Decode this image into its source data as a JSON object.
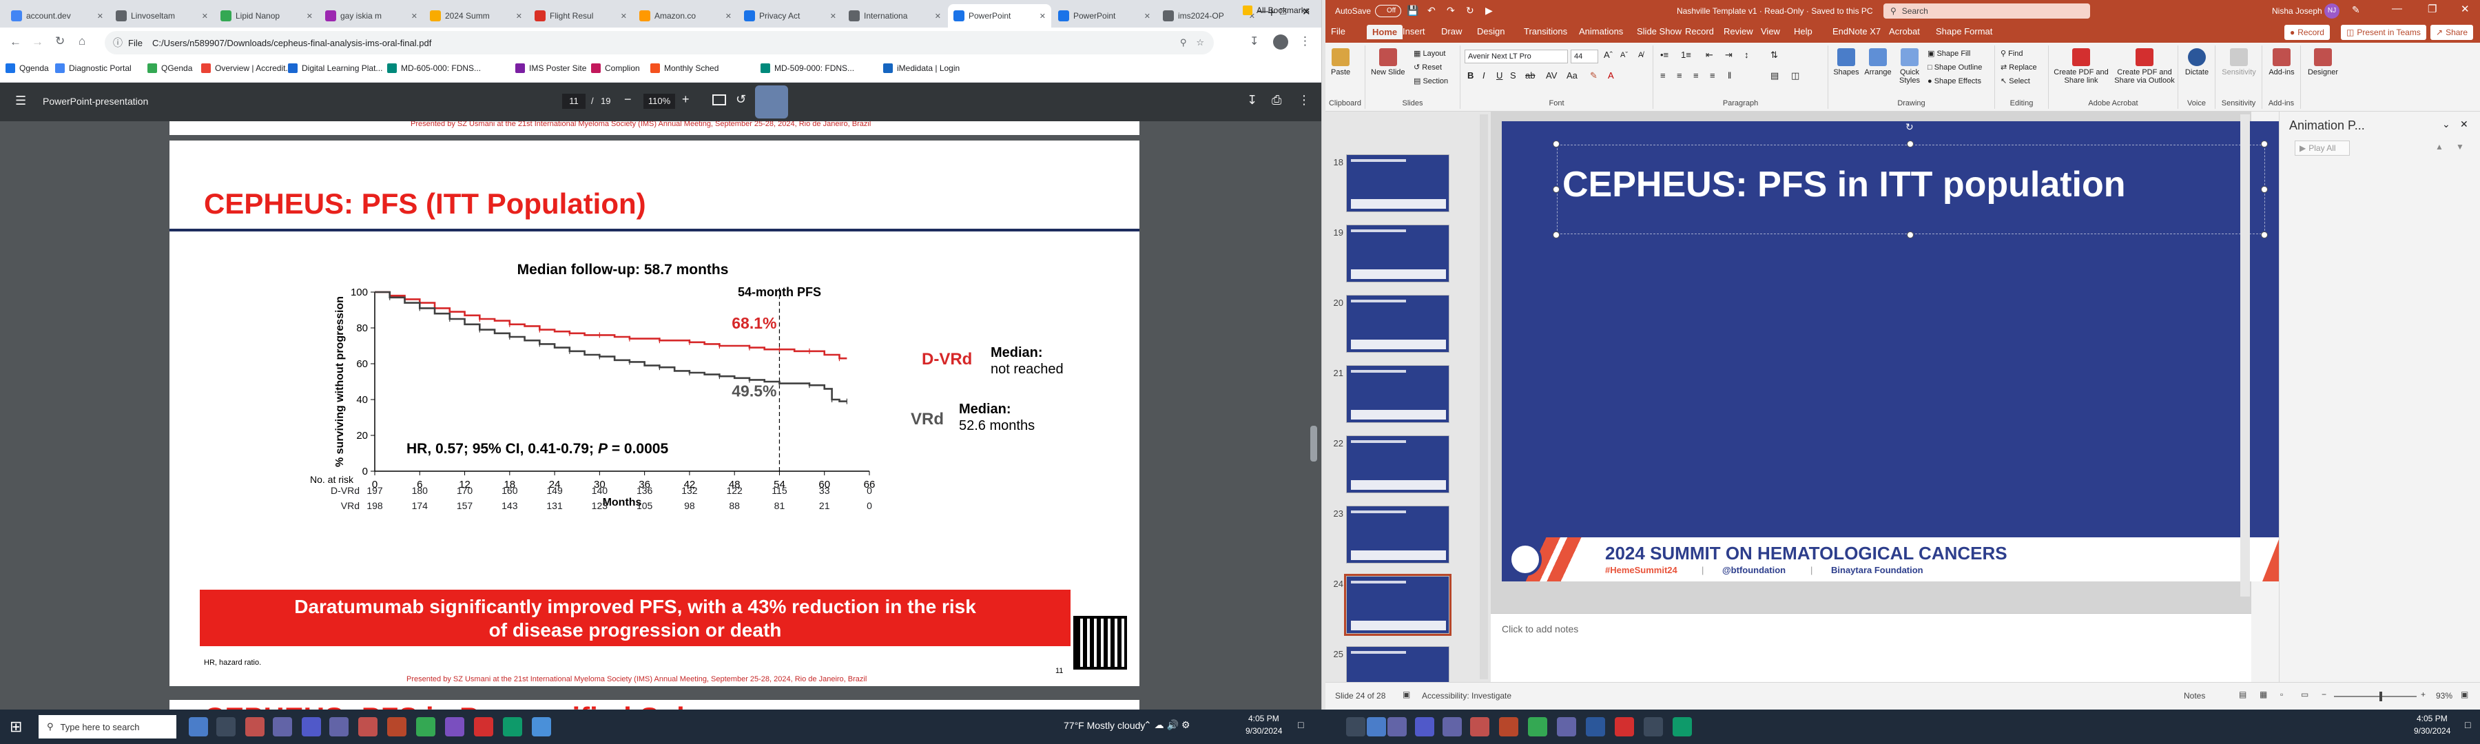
{
  "chrome": {
    "tabs": [
      {
        "label": "account.dev",
        "color": "#4285f4"
      },
      {
        "label": "Linvoseltam",
        "color": "#5f6368"
      },
      {
        "label": "Lipid Nanop",
        "color": "#34a853"
      },
      {
        "label": "gay iskia m",
        "color": "#9c27b0"
      },
      {
        "label": "2024 Summ",
        "color": "#f9ab00"
      },
      {
        "label": "Flight Resul",
        "color": "#d93025"
      },
      {
        "label": "Amazon.co",
        "color": "#ff9900"
      },
      {
        "label": "Privacy Act",
        "color": "#1a73e8"
      },
      {
        "label": "Internationa",
        "color": "#5f6368"
      },
      {
        "label": "PowerPoint",
        "color": "#1a73e8"
      },
      {
        "label": "PowerPoint",
        "color": "#1a73e8"
      },
      {
        "label": "ims2024-OP",
        "color": "#5f6368"
      }
    ],
    "active_tab_index": 9,
    "new_tab_symbol": "+",
    "address_scheme": "File",
    "address_url": "C:/Users/n589907/Downloads/cepheus-final-analysis-ims-oral-final.pdf",
    "bookmarks": [
      "Qgenda",
      "Diagnostic Portal",
      "QGenda",
      "Overview | Accredit...",
      "Digital Learning Plat...",
      "MD-605-000: FDNS...",
      "IMS Poster Site",
      "Complion",
      "Monthly Sched",
      "MD-509-000: FDNS...",
      "iMedidata | Login"
    ],
    "all_bookmarks": "All Bookmarks"
  },
  "pdf": {
    "title": "PowerPoint-presentation",
    "page_current": "11",
    "page_total": "19",
    "zoom": "110%",
    "slide": {
      "prev_slide_text": "Presented by SZ Usmani at the 21st International Myeloma Society (IMS) Annual Meeting, September 25-28, 2024, Rio de Janeiro, Brazil",
      "title": "CEPHEUS: PFS (ITT Population)",
      "followup": "Median follow-up: 58.7 months",
      "landmark_label": "54-month PFS",
      "pct_dvrd": "68.1%",
      "pct_vrd": "49.5%",
      "label_dvrd": "D-VRd",
      "label_vrd": "VRd",
      "median_dvrd_title": "Median:",
      "median_dvrd_value": "not reached",
      "median_vrd_title": "Median:",
      "median_vrd_value": "52.6 months",
      "hr_text": "HR, 0.57; 95% CI, 0.41-0.79;",
      "p_label": "P",
      "p_value": " = 0.0005",
      "y_axis_label": "% surviving without progression",
      "x_axis_label": "Months",
      "risk_header": "No. at risk",
      "risk_rows": [
        {
          "arm": "D-VRd",
          "values": [
            "197",
            "180",
            "170",
            "160",
            "149",
            "140",
            "136",
            "132",
            "122",
            "115",
            "33",
            "0"
          ]
        },
        {
          "arm": "VRd",
          "values": [
            "198",
            "174",
            "157",
            "143",
            "131",
            "123",
            "105",
            "98",
            "88",
            "81",
            "21",
            "0"
          ]
        }
      ],
      "banner_line1": "Daratumumab significantly improved PFS, with a 43% reduction in the risk",
      "banner_line2": "of disease progression or death",
      "footnote": "HR, hazard ratio.",
      "presented_by": "Presented by SZ Usmani at the 21st International Myeloma Society (IMS) Annual Meeting, September 25-28, 2024, Rio de Janeiro, Brazil",
      "slide_number": "11",
      "next_title": "CEPHEUS: PFS in Prespecified Subgroups"
    }
  },
  "chart_data": {
    "type": "line",
    "title": "Median follow-up: 58.7 months",
    "xlabel": "Months",
    "ylabel": "% surviving without progression",
    "xlim": [
      0,
      66
    ],
    "ylim": [
      0,
      100
    ],
    "xticks": [
      0,
      6,
      12,
      18,
      24,
      30,
      36,
      42,
      48,
      54,
      60,
      66
    ],
    "yticks": [
      0,
      20,
      40,
      60,
      80,
      100
    ],
    "series": [
      {
        "name": "D-VRd",
        "color": "#d62728",
        "x": [
          0,
          2,
          4,
          6,
          8,
          10,
          12,
          14,
          16,
          18,
          20,
          22,
          24,
          26,
          28,
          30,
          32,
          34,
          36,
          38,
          40,
          42,
          44,
          46,
          48,
          50,
          52,
          54,
          56,
          58,
          60,
          62,
          63
        ],
        "y": [
          100,
          98,
          96,
          94,
          91,
          89,
          87,
          85,
          84,
          82,
          81,
          79,
          78,
          77,
          76,
          76,
          75,
          74,
          74,
          73,
          73,
          72,
          71,
          70,
          70,
          69,
          68,
          68,
          67,
          67,
          65,
          63,
          63
        ]
      },
      {
        "name": "VRd",
        "color": "#404040",
        "x": [
          0,
          2,
          4,
          6,
          8,
          10,
          12,
          14,
          16,
          18,
          20,
          22,
          24,
          26,
          28,
          30,
          32,
          34,
          36,
          38,
          40,
          42,
          44,
          46,
          48,
          50,
          52,
          54,
          56,
          58,
          60,
          61,
          62,
          63
        ],
        "y": [
          100,
          97,
          94,
          91,
          88,
          85,
          82,
          79,
          77,
          75,
          73,
          71,
          69,
          67,
          65,
          64,
          62,
          61,
          59,
          58,
          56,
          55,
          54,
          53,
          52,
          51,
          50,
          49,
          49,
          48,
          46,
          40,
          39,
          39
        ]
      }
    ],
    "annotations": [
      "54-month PFS",
      "68.1%",
      "49.5%"
    ],
    "landmark_x": 54
  },
  "ppt": {
    "autosave_label": "AutoSave",
    "autosave_state": "Off",
    "doc_title": "Nashville Template v1 · Read-Only · Saved to this PC",
    "search_placeholder": "Search",
    "user": "Nisha Joseph",
    "user_initials": "NJ",
    "tabs": [
      "File",
      "Home",
      "Insert",
      "Draw",
      "Design",
      "Transitions",
      "Animations",
      "Slide Show",
      "Record",
      "Review",
      "View",
      "Help",
      "EndNote X7",
      "Acrobat",
      "Shape Format"
    ],
    "active_tab": "Home",
    "record_btn": "Record",
    "present_btn": "Present in Teams",
    "share_btn": "Share",
    "ribbon": {
      "paste": "Paste",
      "new_slide": "New Slide",
      "layout": "Layout",
      "reset": "Reset",
      "section": "Section",
      "font_name": "Avenir Next LT Pro",
      "font_size": "44",
      "shapes": "Shapes",
      "arrange": "Arrange",
      "quick_styles": "Quick Styles",
      "shape_fill": "Shape Fill",
      "shape_outline": "Shape Outline",
      "shape_effects": "Shape Effects",
      "find": "Find",
      "replace": "Replace",
      "select": "Select",
      "create_pdf_share": "Create PDF and Share link",
      "create_pdf_outlook": "Create PDF and Share via Outlook",
      "dictate": "Dictate",
      "sensitivity": "Sensitivity",
      "addins": "Add-ins",
      "designer": "Designer",
      "groups": [
        "Clipboard",
        "Slides",
        "Font",
        "Paragraph",
        "Drawing",
        "Editing",
        "Adobe Acrobat",
        "Voice",
        "Sensitivity",
        "Add-ins"
      ]
    },
    "thumb_numbers": [
      "18",
      "19",
      "20",
      "21",
      "22",
      "23",
      "24",
      "25"
    ],
    "selected_thumb": "24",
    "slide_title": "CEPHEUS: PFS in ITT population",
    "footer_title": "2024 SUMMIT ON HEMATOLOGICAL CANCERS",
    "footer_hashtag": "#HemeSummit24",
    "footer_handle": "@btfoundation",
    "footer_org": "Binaytara Foundation",
    "notes_placeholder": "Click to add notes",
    "animation_pane_title": "Animation P...",
    "play_all": "Play All",
    "status_slide": "Slide 24 of 28",
    "status_accessibility": "Accessibility: Investigate",
    "status_notes": "Notes",
    "zoom": "93%"
  },
  "taskbar": {
    "search_placeholder": "Type here to search",
    "weather": "77°F  Mostly cloudy",
    "time_left": "4:05 PM",
    "date_left": "9/30/2024",
    "time_right": "4:05 PM",
    "date_right": "9/30/2024"
  }
}
